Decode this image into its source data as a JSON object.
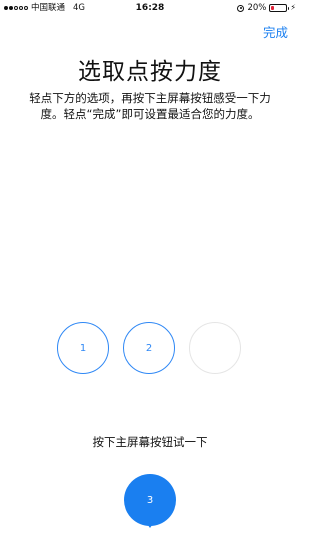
{
  "status_bar": {
    "carrier": "中国联通",
    "network": "4G",
    "time": "16:28",
    "battery_percent": "20%",
    "battery_level": 0.2,
    "signal_bars_filled": 2,
    "signal_bars_total": 5
  },
  "nav": {
    "done_label": "完成"
  },
  "main": {
    "title": "选取点按力度",
    "description": "轻点下方的选项，再按下主屏幕按钮感受一下力度。轻点“完成”即可设置最适合您的力度。",
    "options": [
      {
        "label": "1"
      },
      {
        "label": "2"
      },
      {
        "label": ""
      }
    ],
    "instruction": "按下主屏幕按钮试一下",
    "try_button_label": "3"
  },
  "colors": {
    "accent": "#1a7ff0",
    "option_border": "#2f88f5",
    "inactive_border": "#e5e5e5",
    "battery_low": "#e0243b"
  }
}
